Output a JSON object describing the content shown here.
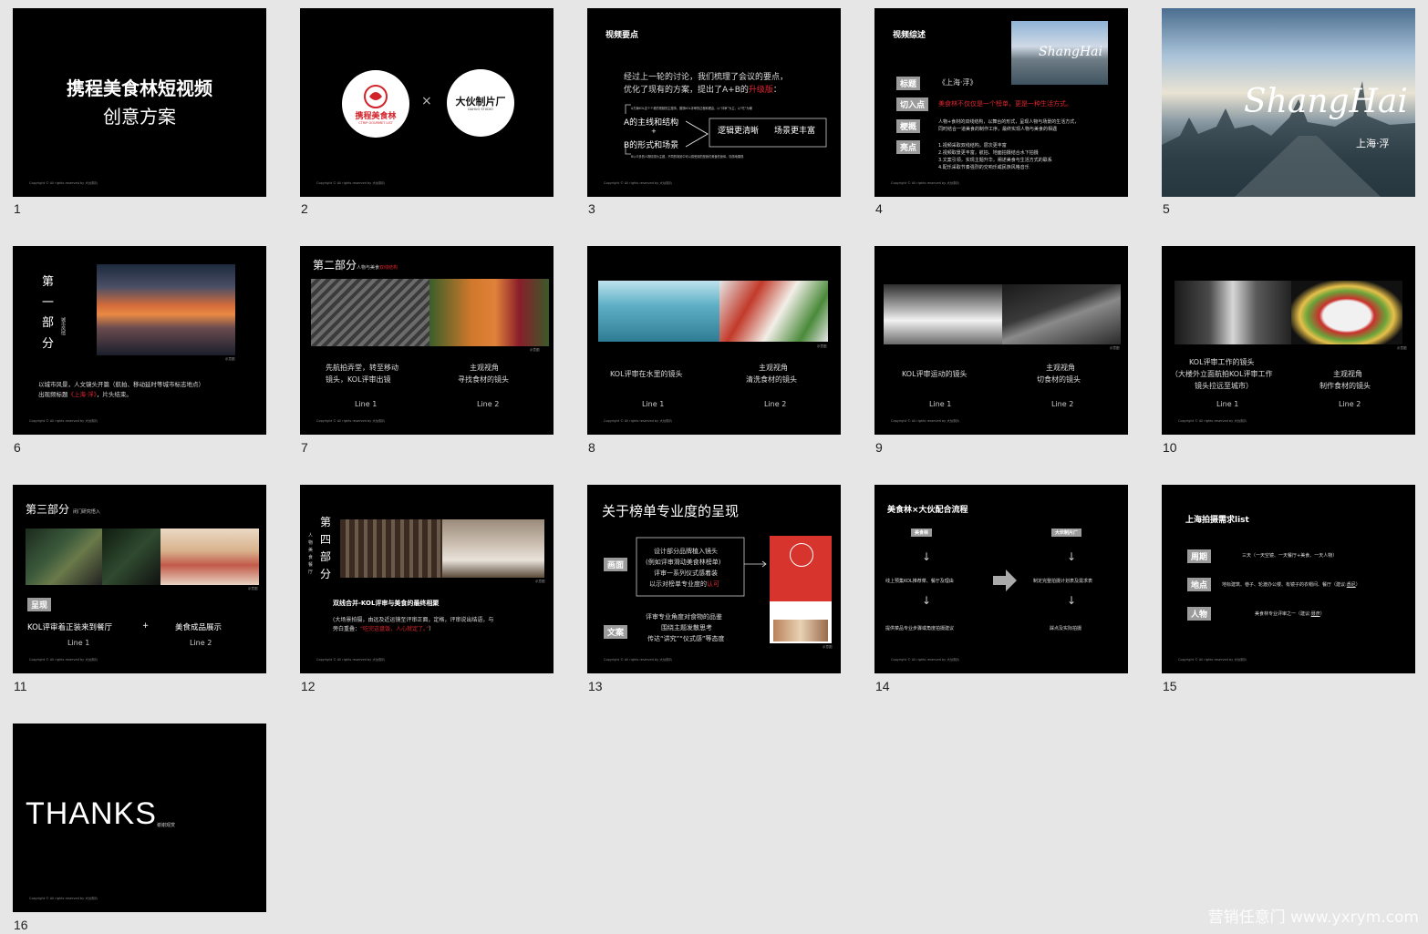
{
  "slide_numbers": [
    "1",
    "2",
    "3",
    "4",
    "5",
    "6",
    "7",
    "8",
    "9",
    "10",
    "11",
    "12",
    "13",
    "14",
    "15",
    "16"
  ],
  "copyright": "Copyright © All rights reserved by 大伙制片",
  "s1": {
    "title": "携程美食林短视频",
    "subtitle": "创意方案"
  },
  "s2": {
    "logo1": "携程美食林",
    "logo1_sub": "CTRIP GOURMET LIST",
    "cross": "×",
    "logo2": "大伙制片厂",
    "logo2_sub": "DAHUO STUDIO"
  },
  "s3": {
    "heading": "视频要点",
    "line1": "经过上一轮的讨论，我们梳理了会议的要点，",
    "line2a": "优化了现有的方案，提出了A+B的",
    "line2b": "升级版",
    "line2c": "：",
    "a": "A的主线和结构",
    "plus": "+",
    "b": "B的形式和场景",
    "box1": "逻辑更清晰",
    "box2": "场景更丰富",
    "note_top": "A方案KOL这个个看的视频的主题事，展现KOL评审的过程和理由，以“评审”为主，以“吃”为辅",
    "note_bottom": "B以众多的人物情感为主题，不同的场景中可以感受到的是我们美食的身体，情感地展现"
  },
  "s4": {
    "heading": "视频综述",
    "tag1": "标题",
    "v1": "《上海·浮》",
    "tag2": "切入点",
    "v2": "美食林不仅仅是一个榜单，更是一种生活方式。",
    "tag3": "梗概",
    "v3a": "人物+食材的双线结构，以舞台的形式，呈现人物与场景的生活方式，",
    "v3b": "同时结合一道美食的制作工序，最终实现人物与美食的相遇",
    "tag4": "亮点",
    "p1": "1.视频采取双线结构，层次更丰富",
    "p2": "2.视频取景更丰富，航拍、地面拍摄结合水下拍摄",
    "p3": "3.文案引领，实现主题升华，阐述美食与生活方式的联系",
    "p4": "4.配乐采取节奏强烈的交响乐或民族风格音乐"
  },
  "s5": {
    "script": "ShangHai",
    "cn": "上海·浮"
  },
  "s6": {
    "side1": "第",
    "side2": "一",
    "side3": "部",
    "side4": "分",
    "sub": "城市风情",
    "desc1": "以城市风景，人文镜头开篇（航拍、移动延时等城市标志地点）",
    "desc2a": "出现频标题",
    "desc2b": "《上海·浮》",
    "desc2c": "，片头结束。",
    "credit": "示意图"
  },
  "s7": {
    "title": "第二部分",
    "sub": "人物与美食",
    "sub_red": "双线结构",
    "l1a": "先航拍弄堂，转至移动",
    "l1b": "镜头，KOL评审出镜",
    "l2a": "主观视角",
    "l2b": "寻找食材的镜头",
    "line1": "Line 1",
    "line2": "Line 2",
    "credit": "示意图"
  },
  "s8": {
    "l1": "KOL评审在水里的镜头",
    "l2a": "主观视角",
    "l2b": "清洗食材的镜头",
    "line1": "Line 1",
    "line2": "Line 2",
    "credit": "示意图"
  },
  "s9": {
    "l1": "KOL评审运动的镜头",
    "l2a": "主观视角",
    "l2b": "切食材的镜头",
    "line1": "Line 1",
    "line2": "Line 2",
    "credit": "示意图"
  },
  "s10": {
    "l1a": "KOL评审工作的镜头",
    "l1b": "（大楼外立面航拍KOL评审工作",
    "l1c": "镜头拉远至城市）",
    "l2a": "主观视角",
    "l2b": "制作食材的镜头",
    "line1": "Line 1",
    "line2": "Line 2",
    "credit": "示意图"
  },
  "s11": {
    "title": "第三部分",
    "sub": "闭门研究悟入",
    "tag": "呈现",
    "l1": "KOL评审着正装来到餐厅",
    "plus": "+",
    "l2": "美食成品展示",
    "line1": "Line 1",
    "line2": "Line 2",
    "credit": "示意图"
  },
  "s12": {
    "side": [
      "第",
      "四",
      "部",
      "分"
    ],
    "vert": [
      "人",
      "物",
      "美",
      "食",
      "餐",
      "厅"
    ],
    "h": "双线合并-KOL评审与美食的最终相聚",
    "d1": "(大场景拍摄，由远及近运镜至评审正面，定格，评审说出结语，与",
    "d2a": "旁白重叠：",
    "d2b": "“吃完这盘饭，人心就定了。”",
    "d2c": "）",
    "credit": "示意图"
  },
  "s13": {
    "title": "关于榜单专业度的呈现",
    "tag1": "画面",
    "b1": "设计部分品牌植入镜头",
    "b2": "(例如评审滑动美食林榜单)",
    "b3": "评审一系列仪式感着装",
    "b4a": "以示对榜单专业度的",
    "b4b": "认可",
    "tag2": "文案",
    "c1": "评审专业角度对食物的品鉴",
    "c2": "围绕主题发散思考",
    "c3": "传达“讲究”“仪式感”等态度",
    "credit": "示意图"
  },
  "s14": {
    "title": "美食林×大伙配合流程",
    "left": "美食林",
    "right": "大伙制片厂",
    "ls1": "线上预集KOL推荐菜、餐厅及理由",
    "ls2": "提供菜品专业步骤或角度拍摄建议",
    "rs1": "制定完整拍摄计划表及需求表",
    "rs2": "踩点及实际拍摄"
  },
  "s15": {
    "title": "上海拍摄需求list",
    "tag1": "周期",
    "v1": "三天（一天空镜、一天餐厅+美食、一天人物）",
    "tag2": "地点",
    "v2": "地标建筑、巷子、轮渡办公楼、有镜子的衣帽间、餐厅（建议:",
    "v2u": "悉尼",
    "v2e": "）",
    "tag3": "人物",
    "v3": "美食林专业评审之一（建议:",
    "v3u": "聂彦",
    "v3e": "）"
  },
  "s16": {
    "big": "THANKS",
    "small": "谢谢观赏"
  },
  "watermark": "营销任意门 www.yxrym.com"
}
